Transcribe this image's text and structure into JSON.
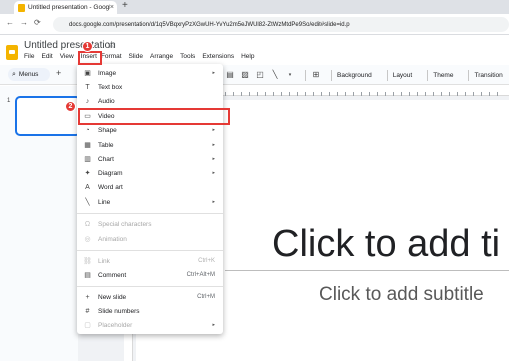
{
  "browser": {
    "tab_title": "Untitled presentation - Google",
    "tab_close": "×",
    "new_tab": "+",
    "url": "docs.google.com/presentation/d/1q5VBqxryPzXGwUH-YvYu2m5eJWUl82-ZtWzMtdPe9So/edit#slide=id.p",
    "back": "←",
    "forward": "→",
    "reload": "⟳"
  },
  "docs": {
    "title": "Untitled presentation",
    "star": "☆",
    "menu": [
      "File",
      "Edit",
      "View",
      "Insert",
      "Format",
      "Slide",
      "Arrange",
      "Tools",
      "Extensions",
      "Help"
    ]
  },
  "toolbar": {
    "menus_label": "Menus",
    "plus": "+",
    "background_label": "Background",
    "layout_label": "Layout",
    "theme_label": "Theme",
    "transition_label": "Transition"
  },
  "filmstrip": {
    "slide_number": "1"
  },
  "slide": {
    "title_placeholder": "Click to add ti",
    "subtitle_placeholder": "Click to add subtitle"
  },
  "insert_menu": {
    "items": [
      {
        "label": "Image",
        "icon": "▣",
        "arrow": "▸"
      },
      {
        "label": "Text box",
        "icon": "T",
        "arrow": ""
      },
      {
        "label": "Audio",
        "icon": "♪",
        "arrow": ""
      },
      {
        "label": "Video",
        "icon": "▭",
        "arrow": ""
      },
      {
        "label": "Shape",
        "icon": "◔",
        "arrow": "▸"
      },
      {
        "label": "Table",
        "icon": "▦",
        "arrow": "▸"
      },
      {
        "label": "Chart",
        "icon": "▥",
        "arrow": "▸"
      },
      {
        "label": "Diagram",
        "icon": "✦",
        "arrow": "▸"
      },
      {
        "label": "Word art",
        "icon": "A",
        "arrow": ""
      },
      {
        "label": "Line",
        "icon": "╲",
        "arrow": "▸"
      },
      {
        "label": "Special characters",
        "icon": "Ω",
        "arrow": ""
      },
      {
        "label": "Animation",
        "icon": "◎",
        "arrow": ""
      },
      {
        "label": "Link",
        "icon": "⛓",
        "shortcut": "Ctrl+K"
      },
      {
        "label": "Comment",
        "icon": "▤",
        "shortcut": "Ctrl+Alt+M"
      },
      {
        "label": "New slide",
        "icon": "+",
        "shortcut": "Ctrl+M"
      },
      {
        "label": "Slide numbers",
        "icon": "#",
        "shortcut": ""
      },
      {
        "label": "Placeholder",
        "icon": "▢",
        "arrow": "▸"
      }
    ]
  },
  "annotations": {
    "step1": "1",
    "step2": "2",
    "color": "#e53935"
  }
}
